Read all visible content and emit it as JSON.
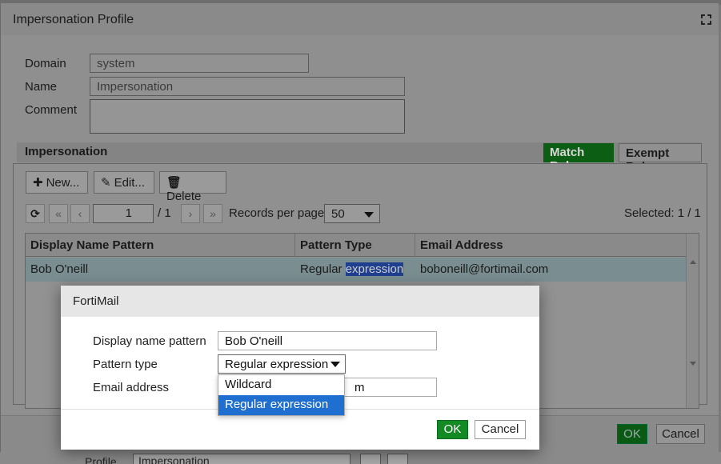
{
  "main_dialog": {
    "title": "Impersonation Profile",
    "fields": {
      "domain_label": "Domain",
      "domain_value": "system",
      "name_label": "Name",
      "name_value": "Impersonation",
      "comment_label": "Comment",
      "comment_value": ""
    },
    "section_title": "Impersonation",
    "tabs": [
      {
        "label": "Match Rule",
        "active": true
      },
      {
        "label": "Exempt Rule",
        "active": false
      }
    ],
    "toolbar": {
      "new_label": "New...",
      "edit_label": "Edit...",
      "delete_label": "Delete"
    },
    "pagination": {
      "page": "1",
      "total_pages": "/ 1",
      "records_label": "Records per page",
      "records_per_page": "50",
      "selected": "Selected: 1 / 1"
    },
    "table": {
      "columns": [
        "Display Name Pattern",
        "Pattern Type",
        "Email Address"
      ],
      "rows": [
        {
          "display_name": "Bob O'neill",
          "pattern_type_a": "Regular ",
          "pattern_type_b": "expression",
          "email": "boboneill@fortimail.com"
        }
      ]
    },
    "footer": {
      "ok_label": "OK",
      "cancel_label": "Cancel"
    }
  },
  "background": {
    "profile_label": "Profile",
    "profile_value": "Impersonation"
  },
  "edit_dialog": {
    "title": "FortiMail",
    "display_name_label": "Display name pattern",
    "display_name_value": "Bob O'neill",
    "pattern_type_label": "Pattern type",
    "pattern_type_value": "Regular expression",
    "pattern_type_options": [
      "Wildcard",
      "Regular expression"
    ],
    "email_label": "Email address",
    "email_value_visible": "m",
    "ok_label": "OK",
    "cancel_label": "Cancel"
  },
  "colors": {
    "accent_green": "#138a24",
    "selection_blue": "#1f6fd1"
  }
}
